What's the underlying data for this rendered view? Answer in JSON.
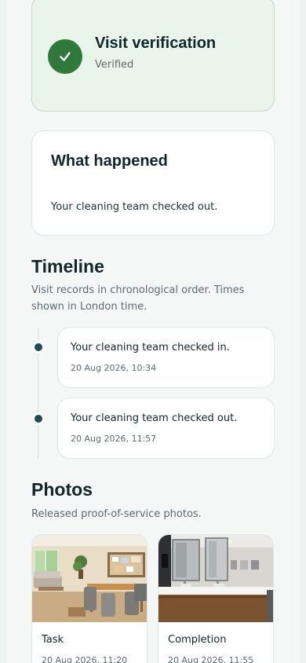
{
  "verification": {
    "title": "Visit verification",
    "status": "Verified",
    "accent_color": "#2f7a3b"
  },
  "what_happened": {
    "title": "What happened",
    "text": "Your cleaning team checked out."
  },
  "timeline": {
    "title": "Timeline",
    "subtitle": "Visit records in chronological order. Times shown in London time.",
    "events": [
      {
        "label": "Your cleaning team checked in.",
        "time": "20 Aug 2026, 10:34"
      },
      {
        "label": "Your cleaning team checked out.",
        "time": "20 Aug 2026, 11:57"
      }
    ]
  },
  "photos": {
    "title": "Photos",
    "subtitle": "Released proof-of-service photos.",
    "items": [
      {
        "label": "Task",
        "time": "20 Aug 2026, 11:20",
        "image": "living-dining-room-photo"
      },
      {
        "label": "Completion",
        "time": "20 Aug 2026, 11:55",
        "image": "bathroom-vanity-photo"
      }
    ]
  }
}
